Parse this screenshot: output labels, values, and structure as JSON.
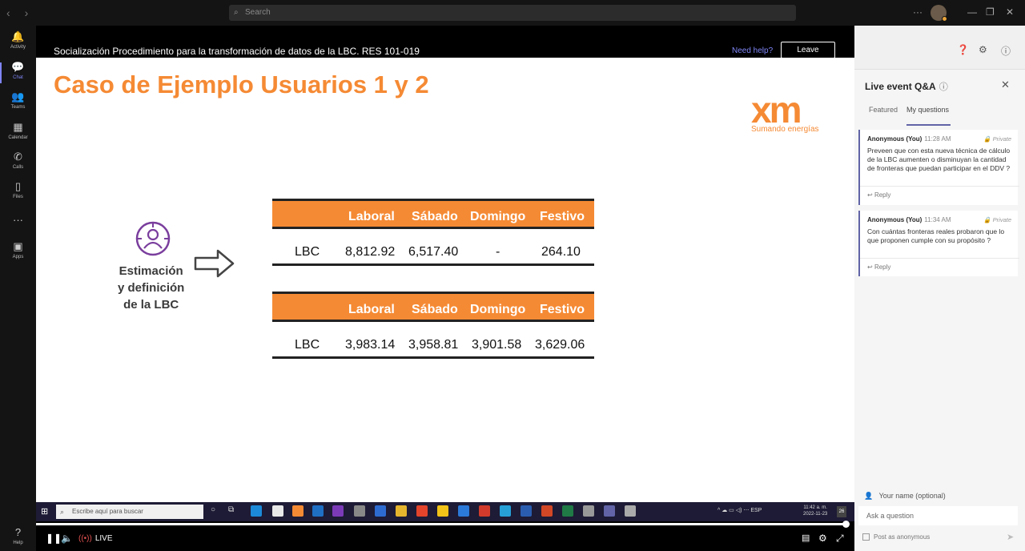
{
  "topbar": {
    "search_placeholder": "Search",
    "more": "···"
  },
  "rail": [
    {
      "label": "Activity",
      "icon": "bell-icon",
      "glyph": "🔔"
    },
    {
      "label": "Chat",
      "icon": "chat-icon",
      "glyph": "💬"
    },
    {
      "label": "Teams",
      "icon": "teams-icon",
      "glyph": "👥"
    },
    {
      "label": "Calendar",
      "icon": "calendar-icon",
      "glyph": "▦"
    },
    {
      "label": "Calls",
      "icon": "phone-icon",
      "glyph": "✆"
    },
    {
      "label": "Files",
      "icon": "file-icon",
      "glyph": "▯"
    },
    {
      "label": "...",
      "icon": "more-icon",
      "glyph": "···"
    },
    {
      "label": "Apps",
      "icon": "apps-icon",
      "glyph": "▣"
    },
    {
      "label": "Help",
      "icon": "help-icon",
      "glyph": "?"
    }
  ],
  "meeting": {
    "title": "Socialización Procedimiento para la transformación de datos de la LBC. RES 101-019",
    "help_link": "Need help?",
    "leave_label": "Leave"
  },
  "slide": {
    "title": "Caso de Ejemplo Usuarios 1 y 2",
    "logo_text": "xm",
    "logo_tagline": "Sumando energías",
    "side_label_1": "Estimación",
    "side_label_2": "y definición",
    "side_label_3": "de la LBC",
    "table1": {
      "headers": [
        "Laboral",
        "Sábado",
        "Domingo",
        "Festivo"
      ],
      "row_label": "LBC",
      "values": [
        "8,812.92",
        "6,517.40",
        "-",
        "264.10"
      ]
    },
    "table2": {
      "headers": [
        "Laboral",
        "Sábado",
        "Domingo",
        "Festivo"
      ],
      "row_label": "LBC",
      "values": [
        "3,983.14",
        "3,958.81",
        "3,901.58",
        "3,629.06"
      ]
    }
  },
  "taskbar": {
    "search_placeholder": "Escribe aquí para buscar",
    "lang": "ESP",
    "time": "11:42 a. m.",
    "date": "2022-11-23",
    "notifications": "26"
  },
  "player": {
    "live_label": "LIVE"
  },
  "panel": {
    "title": "Live event Q&A",
    "tab_featured": "Featured",
    "tab_mine": "My questions",
    "questions": [
      {
        "author": "Anonymous (You)",
        "time": "11:28 AM",
        "privacy": "Private",
        "text": "Preveen que con esta nueva técnica de cálculo de la LBC aumenten o disminuyan la cantidad de fronteras que puedan participar en el DDV ?",
        "reply": "Reply"
      },
      {
        "author": "Anonymous (You)",
        "time": "11:34 AM",
        "privacy": "Private",
        "text": "Con cuántas fronteras reales probaron que lo que proponen cumple con su propósito ?",
        "reply": "Reply"
      }
    ],
    "name_field": "Your name (optional)",
    "ask_placeholder": "Ask a question",
    "anonymous_label": "Post as anonymous"
  }
}
